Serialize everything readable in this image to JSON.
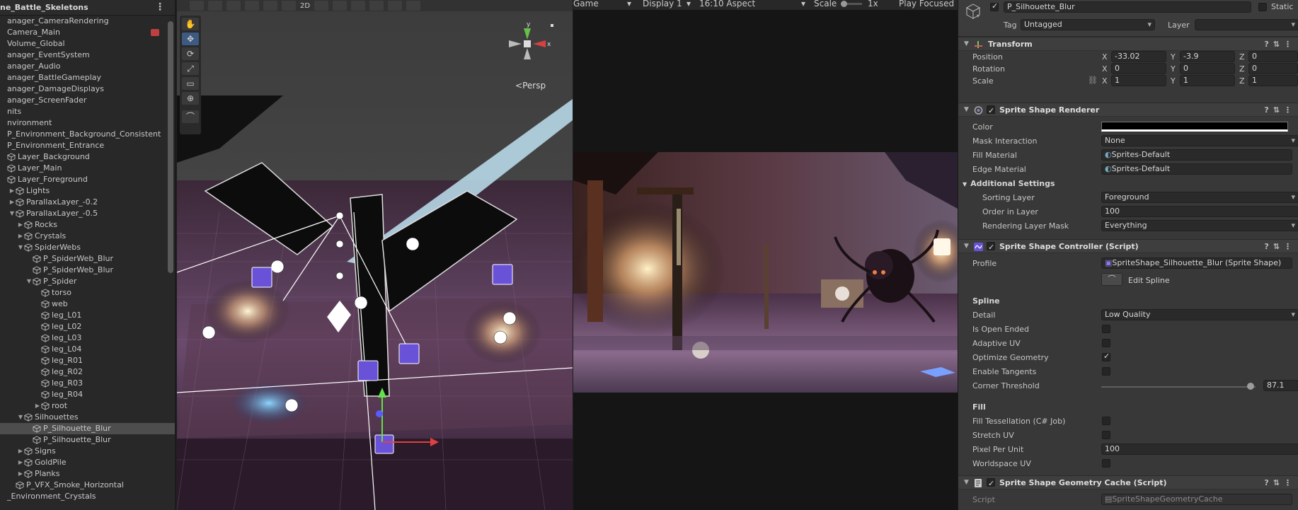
{
  "hierarchy": {
    "title": "ne_Battle_Skeletons",
    "items": [
      {
        "label": "anager_CameraRendering",
        "indent": 0,
        "arrow": "",
        "cube": false
      },
      {
        "label": "Camera_Main",
        "indent": 0,
        "arrow": "",
        "cube": false,
        "icon": "camera"
      },
      {
        "label": "Volume_Global",
        "indent": 0,
        "arrow": "",
        "cube": false
      },
      {
        "label": "anager_EventSystem",
        "indent": 0,
        "arrow": "",
        "cube": false
      },
      {
        "label": "anager_Audio",
        "indent": 0,
        "arrow": "",
        "cube": false
      },
      {
        "label": "anager_BattleGameplay",
        "indent": 0,
        "arrow": "",
        "cube": false
      },
      {
        "label": "anager_DamageDisplays",
        "indent": 0,
        "arrow": "",
        "cube": false
      },
      {
        "label": "anager_ScreenFader",
        "indent": 0,
        "arrow": "",
        "cube": false
      },
      {
        "label": "nits",
        "indent": 0,
        "arrow": "",
        "cube": false
      },
      {
        "label": "nvironment",
        "indent": 0,
        "arrow": "",
        "cube": false
      },
      {
        "label": "P_Environment_Background_Consistent",
        "indent": 0,
        "arrow": "",
        "cube": false
      },
      {
        "label": "P_Environment_Entrance",
        "indent": 0,
        "arrow": "",
        "cube": false
      },
      {
        "label": "Layer_Background",
        "indent": 0,
        "arrow": "",
        "cube": true
      },
      {
        "label": "Layer_Main",
        "indent": 0,
        "arrow": "",
        "cube": true
      },
      {
        "label": "Layer_Foreground",
        "indent": 0,
        "arrow": "",
        "cube": true
      },
      {
        "label": "Lights",
        "indent": 1,
        "arrow": "▶",
        "cube": true
      },
      {
        "label": "ParallaxLayer_-0.2",
        "indent": 1,
        "arrow": "▶",
        "cube": true
      },
      {
        "label": "ParallaxLayer_-0.5",
        "indent": 1,
        "arrow": "▼",
        "cube": true
      },
      {
        "label": "Rocks",
        "indent": 2,
        "arrow": "▶",
        "cube": true
      },
      {
        "label": "Crystals",
        "indent": 2,
        "arrow": "▶",
        "cube": true
      },
      {
        "label": "SpiderWebs",
        "indent": 2,
        "arrow": "▼",
        "cube": true
      },
      {
        "label": "P_SpiderWeb_Blur",
        "indent": 3,
        "arrow": "",
        "cube": true
      },
      {
        "label": "P_SpiderWeb_Blur",
        "indent": 3,
        "arrow": "",
        "cube": true
      },
      {
        "label": "P_Spider",
        "indent": 3,
        "arrow": "▼",
        "cube": true
      },
      {
        "label": "torso",
        "indent": 4,
        "arrow": "",
        "cube": true
      },
      {
        "label": "web",
        "indent": 4,
        "arrow": "",
        "cube": true
      },
      {
        "label": "leg_L01",
        "indent": 4,
        "arrow": "",
        "cube": true
      },
      {
        "label": "leg_L02",
        "indent": 4,
        "arrow": "",
        "cube": true
      },
      {
        "label": "leg_L03",
        "indent": 4,
        "arrow": "",
        "cube": true
      },
      {
        "label": "leg_L04",
        "indent": 4,
        "arrow": "",
        "cube": true
      },
      {
        "label": "leg_R01",
        "indent": 4,
        "arrow": "",
        "cube": true
      },
      {
        "label": "leg_R02",
        "indent": 4,
        "arrow": "",
        "cube": true
      },
      {
        "label": "leg_R03",
        "indent": 4,
        "arrow": "",
        "cube": true
      },
      {
        "label": "leg_R04",
        "indent": 4,
        "arrow": "",
        "cube": true
      },
      {
        "label": "root",
        "indent": 4,
        "arrow": "▶",
        "cube": true
      },
      {
        "label": "Silhouettes",
        "indent": 2,
        "arrow": "▼",
        "cube": true
      },
      {
        "label": "P_Silhouette_Blur",
        "indent": 3,
        "arrow": "",
        "cube": true,
        "selected": true
      },
      {
        "label": "P_Silhouette_Blur",
        "indent": 3,
        "arrow": "",
        "cube": true
      },
      {
        "label": "Signs",
        "indent": 2,
        "arrow": "▶",
        "cube": true
      },
      {
        "label": "GoldPile",
        "indent": 2,
        "arrow": "▶",
        "cube": true
      },
      {
        "label": "Planks",
        "indent": 2,
        "arrow": "▶",
        "cube": true
      },
      {
        "label": "P_VFX_Smoke_Horizontal",
        "indent": 1,
        "arrow": "",
        "cube": true
      },
      {
        "label": "_Environment_Crystals",
        "indent": 0,
        "arrow": "",
        "cube": false
      }
    ]
  },
  "scene": {
    "toolbar_2d": "2D",
    "persp_label": "Persp",
    "gizmo_y": "y",
    "gizmo_x": "x"
  },
  "game": {
    "tab": "Game",
    "display": "Display 1",
    "aspect": "16:10 Aspect",
    "scale_label": "Scale",
    "scale_value": "1x",
    "play_focused": "Play Focused"
  },
  "inspector": {
    "object_name": "P_Silhouette_Blur",
    "static_label": "Static",
    "tag_label": "Tag",
    "tag_value": "Untagged",
    "layer_label": "Layer",
    "transform": {
      "title": "Transform",
      "position_label": "Position",
      "rotation_label": "Rotation",
      "scale_label": "Scale",
      "axis_x": "X",
      "axis_y": "Y",
      "axis_z": "Z",
      "position": [
        "-33.02",
        "-3.9",
        "0"
      ],
      "rotation": [
        "0",
        "0",
        "0"
      ],
      "scale": [
        "1",
        "1",
        "1"
      ]
    },
    "renderer": {
      "title": "Sprite Shape Renderer",
      "color_label": "Color",
      "mask_label": "Mask Interaction",
      "mask_value": "None",
      "fill_label": "Fill Material",
      "fill_value": "Sprites-Default",
      "edge_label": "Edge Material",
      "edge_value": "Sprites-Default",
      "additional_label": "Additional Settings",
      "sorting_label": "Sorting Layer",
      "sorting_value": "Foreground",
      "order_label": "Order in Layer",
      "order_value": "100",
      "rendering_label": "Rendering Layer Mask",
      "rendering_value": "Everything"
    },
    "controller": {
      "title": "Sprite Shape Controller (Script)",
      "profile_label": "Profile",
      "profile_value": "SpriteShape_Silhouette_Blur (Sprite Shape)",
      "edit_spline": "Edit Spline",
      "spline_header": "Spline",
      "detail_label": "Detail",
      "detail_value": "Low Quality",
      "open_ended_label": "Is Open Ended",
      "adaptive_uv_label": "Adaptive UV",
      "optimize_label": "Optimize Geometry",
      "tangents_label": "Enable Tangents",
      "corner_label": "Corner Threshold",
      "corner_value": "87.1",
      "corner_fraction": 0.968,
      "fill_header": "Fill",
      "tessellation_label": "Fill Tessellation (C# Job)",
      "stretch_label": "Stretch UV",
      "ppu_label": "Pixel Per Unit",
      "ppu_value": "100",
      "worldspace_label": "Worldspace UV",
      "checks": {
        "open_ended": false,
        "adaptive_uv": false,
        "optimize": true,
        "tangents": false,
        "tessellation": false,
        "stretch": false,
        "worldspace": false
      }
    },
    "cache": {
      "title": "Sprite Shape Geometry Cache (Script)",
      "script_label": "Script",
      "script_value": "SpriteShapeGeometryCache"
    }
  }
}
